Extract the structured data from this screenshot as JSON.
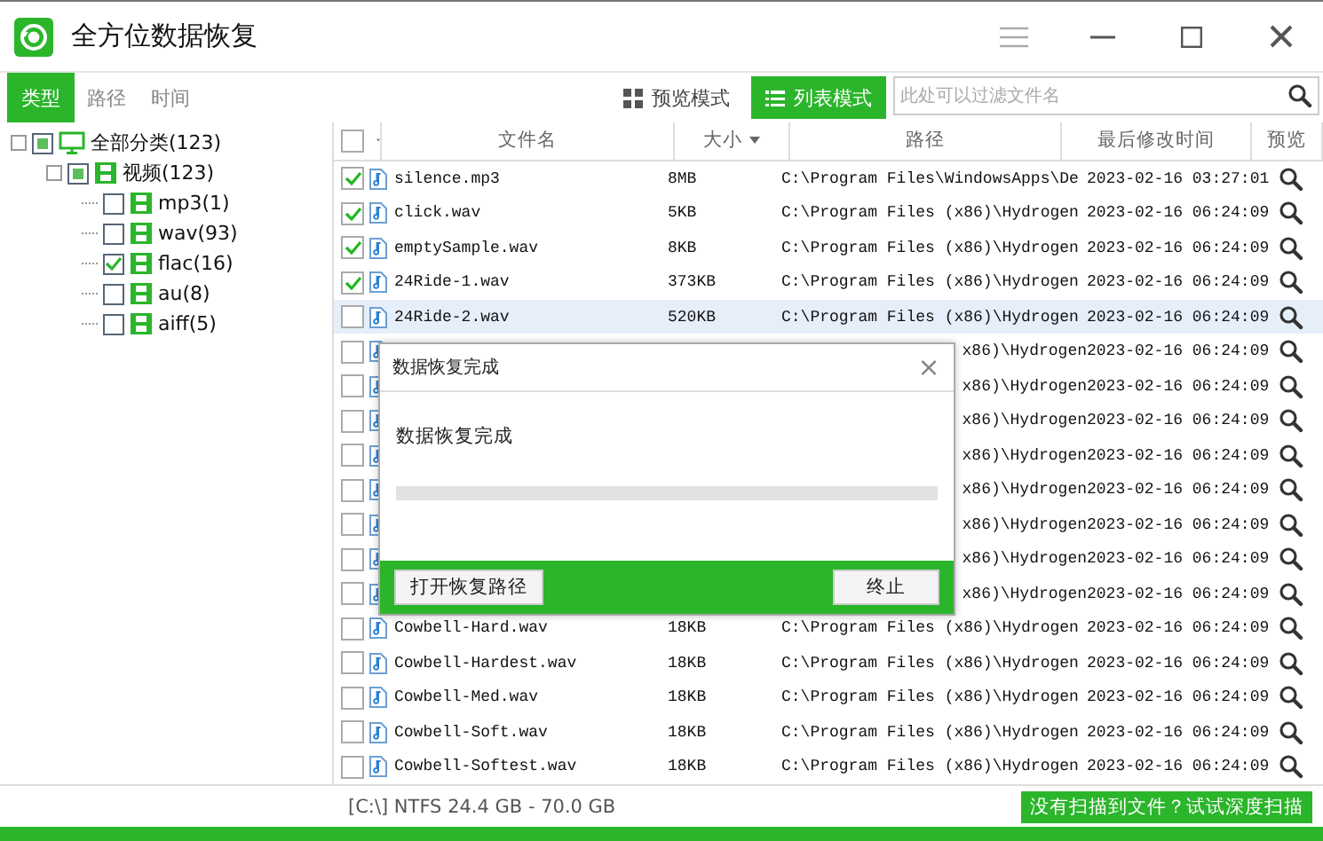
{
  "window": {
    "title": "全方位数据恢复"
  },
  "tabs": [
    {
      "label": "类型",
      "selected": true
    },
    {
      "label": "路径",
      "selected": false
    },
    {
      "label": "时间",
      "selected": false
    }
  ],
  "view_modes": [
    {
      "label": "预览模式",
      "kind": "grid",
      "selected": false
    },
    {
      "label": "列表模式",
      "kind": "list",
      "selected": true
    }
  ],
  "search": {
    "placeholder": "此处可以过滤文件名"
  },
  "tree": [
    {
      "label": "全部分类(123)",
      "checked": false,
      "partial": true,
      "kind": "monitor",
      "children": [
        {
          "label": "视频(123)",
          "checked": false,
          "partial": true,
          "kind": "film",
          "children": [
            {
              "label": "mp3(1)",
              "checked": false,
              "kind": "film"
            },
            {
              "label": "wav(93)",
              "checked": false,
              "kind": "film"
            },
            {
              "label": "flac(16)",
              "checked": true,
              "kind": "film"
            },
            {
              "label": "au(8)",
              "checked": false,
              "kind": "film"
            },
            {
              "label": "aiff(5)",
              "checked": false,
              "kind": "film"
            }
          ]
        }
      ]
    }
  ],
  "table": {
    "select_all": {
      "checked": false
    },
    "columns": [
      "文件名",
      "大小",
      "路径",
      "最后修改时间",
      "预览"
    ],
    "rows": [
      {
        "name": "silence.mp3",
        "size": "8MB",
        "path": "C:\\Program Files\\WindowsApps\\De",
        "modified": "2023-02-16 03:27:01",
        "checked": true,
        "selected": false
      },
      {
        "name": "click.wav",
        "size": "5KB",
        "path": "C:\\Program Files (x86)\\Hydrogen",
        "modified": "2023-02-16 06:24:09",
        "checked": true,
        "selected": false
      },
      {
        "name": "emptySample.wav",
        "size": "8KB",
        "path": "C:\\Program Files (x86)\\Hydrogen",
        "modified": "2023-02-16 06:24:09",
        "checked": true,
        "selected": false
      },
      {
        "name": "24Ride-1.wav",
        "size": "373KB",
        "path": "C:\\Program Files (x86)\\Hydrogen",
        "modified": "2023-02-16 06:24:09",
        "checked": true,
        "selected": false
      },
      {
        "name": "24Ride-2.wav",
        "size": "520KB",
        "path": "C:\\Program Files (x86)\\Hydrogen",
        "modified": "2023-02-16 06:24:09",
        "checked": false,
        "selected": true
      },
      {
        "path": "x86)\\Hydrogen",
        "modified": "2023-02-16 06:24:09",
        "checked": false,
        "selected": false
      },
      {
        "path": "x86)\\Hydrogen",
        "modified": "2023-02-16 06:24:09",
        "checked": false,
        "selected": false
      },
      {
        "path": "x86)\\Hydrogen",
        "modified": "2023-02-16 06:24:09",
        "checked": false,
        "selected": false
      },
      {
        "path": "x86)\\Hydrogen",
        "modified": "2023-02-16 06:24:09",
        "checked": false,
        "selected": false
      },
      {
        "path": "x86)\\Hydrogen",
        "modified": "2023-02-16 06:24:09",
        "checked": false,
        "selected": false
      },
      {
        "path": "x86)\\Hydrogen",
        "modified": "2023-02-16 06:24:09",
        "checked": false,
        "selected": false
      },
      {
        "path": "x86)\\Hydrogen",
        "modified": "2023-02-16 06:24:09",
        "checked": false,
        "selected": false
      },
      {
        "path": "x86)\\Hydrogen",
        "modified": "2023-02-16 06:24:09",
        "checked": false,
        "selected": false
      },
      {
        "name": "Cowbell-Hard.wav",
        "size": "18KB",
        "path": "C:\\Program Files (x86)\\Hydrogen",
        "modified": "2023-02-16 06:24:09",
        "checked": false,
        "selected": false
      },
      {
        "name": "Cowbell-Hardest.wav",
        "size": "18KB",
        "path": "C:\\Program Files (x86)\\Hydrogen",
        "modified": "2023-02-16 06:24:09",
        "checked": false,
        "selected": false
      },
      {
        "name": "Cowbell-Med.wav",
        "size": "18KB",
        "path": "C:\\Program Files (x86)\\Hydrogen",
        "modified": "2023-02-16 06:24:09",
        "checked": false,
        "selected": false
      },
      {
        "name": "Cowbell-Soft.wav",
        "size": "18KB",
        "path": "C:\\Program Files (x86)\\Hydrogen",
        "modified": "2023-02-16 06:24:09",
        "checked": false,
        "selected": false
      },
      {
        "name": "Cowbell-Softest.wav",
        "size": "18KB",
        "path": "C:\\Program Files (x86)\\Hydrogen",
        "modified": "2023-02-16 06:24:09",
        "checked": false,
        "selected": false
      }
    ]
  },
  "dialog": {
    "title": "数据恢复完成",
    "close": "×",
    "message": "数据恢复完成",
    "level": 0,
    "buttons": [
      "打开恢复路径",
      "终止"
    ]
  },
  "status_bar": {
    "text": "[C:\\] NTFS 24.4 GB - 70.0 GB",
    "action": "没有扫描到文件？试试深度扫描"
  }
}
